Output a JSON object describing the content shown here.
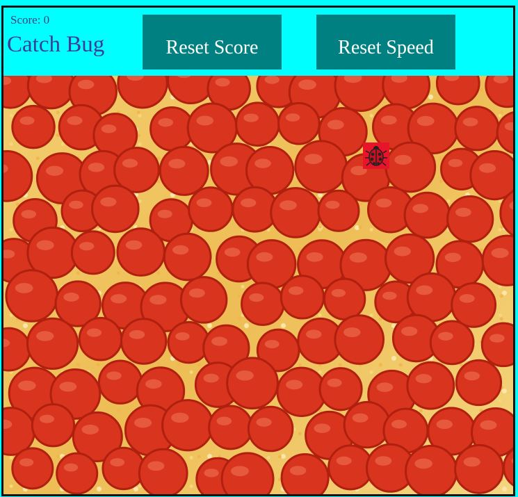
{
  "header": {
    "score_label": "Score: 0",
    "title": "Catch Bug",
    "reset_score_label": "Reset Score",
    "reset_speed_label": "Reset Speed"
  },
  "colors": {
    "page_background": "#00ffff",
    "button_background": "#008080",
    "button_text": "#ffffff",
    "title_text": "#3d3d9a",
    "bug_background": "#e8142a",
    "pepperoni": "#d8341e"
  },
  "board": {
    "background_image": "pepperoni-pizza",
    "bug_icon": "ladybug-icon"
  }
}
